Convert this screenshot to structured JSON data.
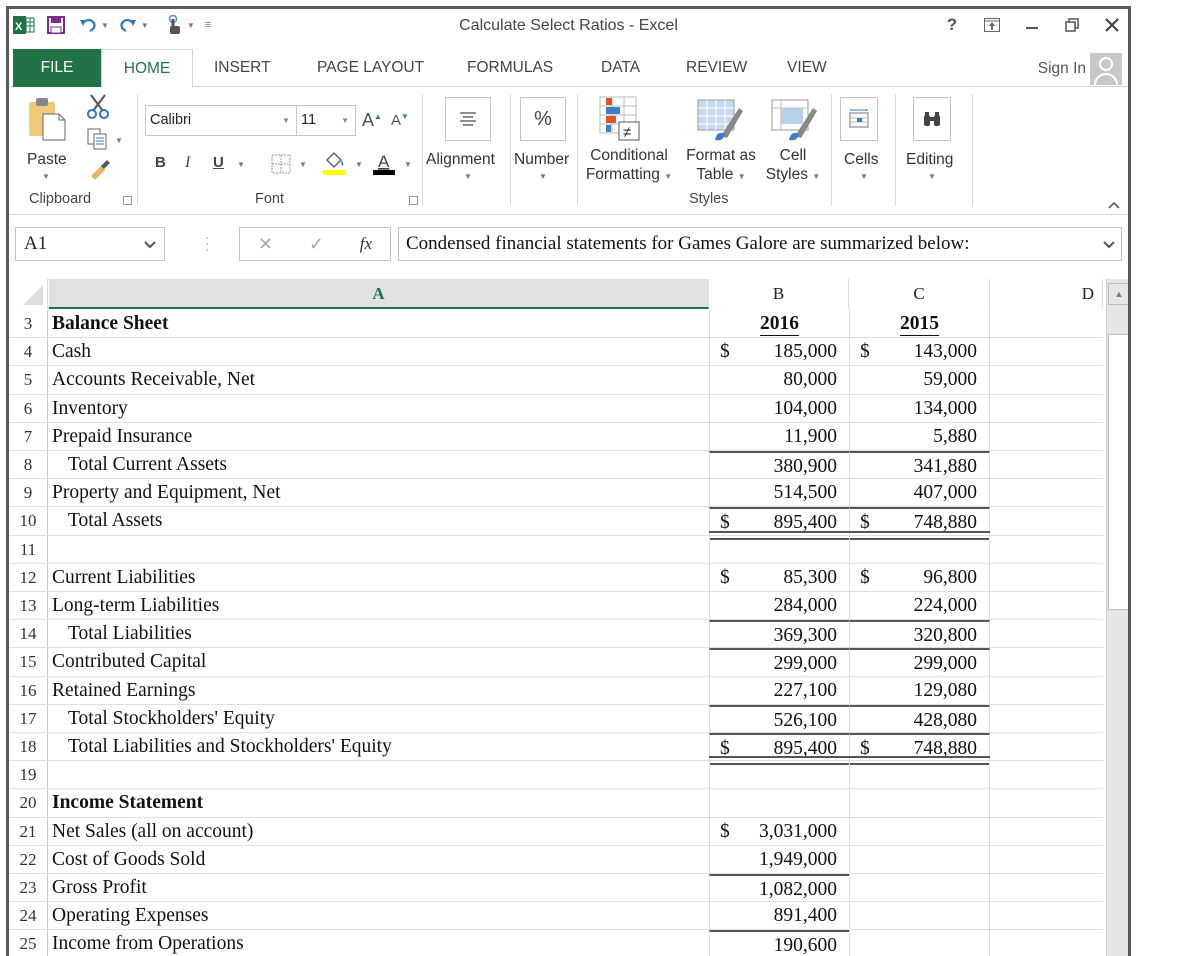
{
  "app": {
    "title": "Calculate Select Ratios - Excel",
    "window_controls": {
      "help": "?",
      "ribbon_display": "ribbon-display-options-icon",
      "minimize": "–",
      "restore": "restore-icon",
      "close": "✕"
    }
  },
  "tabs": [
    {
      "label": "FILE"
    },
    {
      "label": "HOME"
    },
    {
      "label": "INSERT"
    },
    {
      "label": "PAGE LAYOUT"
    },
    {
      "label": "FORMULAS"
    },
    {
      "label": "DATA"
    },
    {
      "label": "REVIEW"
    },
    {
      "label": "VIEW"
    }
  ],
  "signin": {
    "label": "Sign In"
  },
  "ribbon": {
    "clipboard": {
      "paste_label": "Paste",
      "group_label": "Clipboard"
    },
    "font": {
      "font_name": "Calibri",
      "font_size": "11",
      "bold": "B",
      "italic": "I",
      "underline": "U",
      "group_label": "Font",
      "fill_color": "#ffff00",
      "font_color": "#000000"
    },
    "alignment": {
      "label": "Alignment"
    },
    "number": {
      "label": "Number",
      "icon_glyph": "%"
    },
    "styles": {
      "conditional_formatting": [
        "Conditional",
        "Formatting"
      ],
      "format_as_table": [
        "Format as",
        "Table"
      ],
      "cell_styles": [
        "Cell",
        "Styles"
      ],
      "group_label": "Styles"
    },
    "cells": {
      "label": "Cells"
    },
    "editing": {
      "label": "Editing"
    }
  },
  "formula_bar": {
    "name_box": "A1",
    "fx": "fx",
    "content": "Condensed financial statements for Games Galore are summarized below:"
  },
  "columns": [
    {
      "label": "A",
      "selected": true
    },
    {
      "label": "B",
      "selected": false
    },
    {
      "label": "C",
      "selected": false
    },
    {
      "label": "D",
      "selected": false
    }
  ],
  "rows": [
    {
      "num": "3",
      "a": "Balance Sheet",
      "b": "2016",
      "c": "2015"
    },
    {
      "num": "4",
      "a": "Cash",
      "b_cur": "$",
      "b": "185,000",
      "c_cur": "$",
      "c": "143,000"
    },
    {
      "num": "5",
      "a": "Accounts Receivable, Net",
      "b": "80,000",
      "c": "59,000"
    },
    {
      "num": "6",
      "a": "Inventory",
      "b": "104,000",
      "c": "134,000"
    },
    {
      "num": "7",
      "a": "Prepaid Insurance",
      "b": "11,900",
      "c": "5,880"
    },
    {
      "num": "8",
      "a": "Total Current Assets",
      "b": "380,900",
      "c": "341,880"
    },
    {
      "num": "9",
      "a": "Property and Equipment, Net",
      "b": "514,500",
      "c": "407,000"
    },
    {
      "num": "10",
      "a": "Total Assets",
      "b_cur": "$",
      "b": "895,400",
      "c_cur": "$",
      "c": "748,880"
    },
    {
      "num": "11",
      "a": ""
    },
    {
      "num": "12",
      "a": "Current Liabilities",
      "b_cur": "$",
      "b": "85,300",
      "c_cur": "$",
      "c": "96,800"
    },
    {
      "num": "13",
      "a": "Long-term Liabilities",
      "b": "284,000",
      "c": "224,000"
    },
    {
      "num": "14",
      "a": "Total Liabilities",
      "b": "369,300",
      "c": "320,800"
    },
    {
      "num": "15",
      "a": "Contributed Capital",
      "b": "299,000",
      "c": "299,000"
    },
    {
      "num": "16",
      "a": "Retained Earnings",
      "b": "227,100",
      "c": "129,080"
    },
    {
      "num": "17",
      "a": "Total Stockholders' Equity",
      "b": "526,100",
      "c": "428,080"
    },
    {
      "num": "18",
      "a": "Total Liabilities and Stockholders' Equity",
      "b_cur": "$",
      "b": "895,400",
      "c_cur": "$",
      "c": "748,880"
    },
    {
      "num": "19",
      "a": ""
    },
    {
      "num": "20",
      "a": "Income Statement"
    },
    {
      "num": "21",
      "a": "Net Sales (all on account)",
      "b_cur": "$",
      "b": "3,031,000"
    },
    {
      "num": "22",
      "a": "Cost of Goods Sold",
      "b": "1,949,000"
    },
    {
      "num": "23",
      "a": "Gross Profit",
      "b": "1,082,000"
    },
    {
      "num": "24",
      "a": "Operating Expenses",
      "b": "891,400"
    },
    {
      "num": "25",
      "a": "Income from Operations",
      "b": "190,600"
    }
  ],
  "colors": {
    "excel_green": "#217346"
  }
}
